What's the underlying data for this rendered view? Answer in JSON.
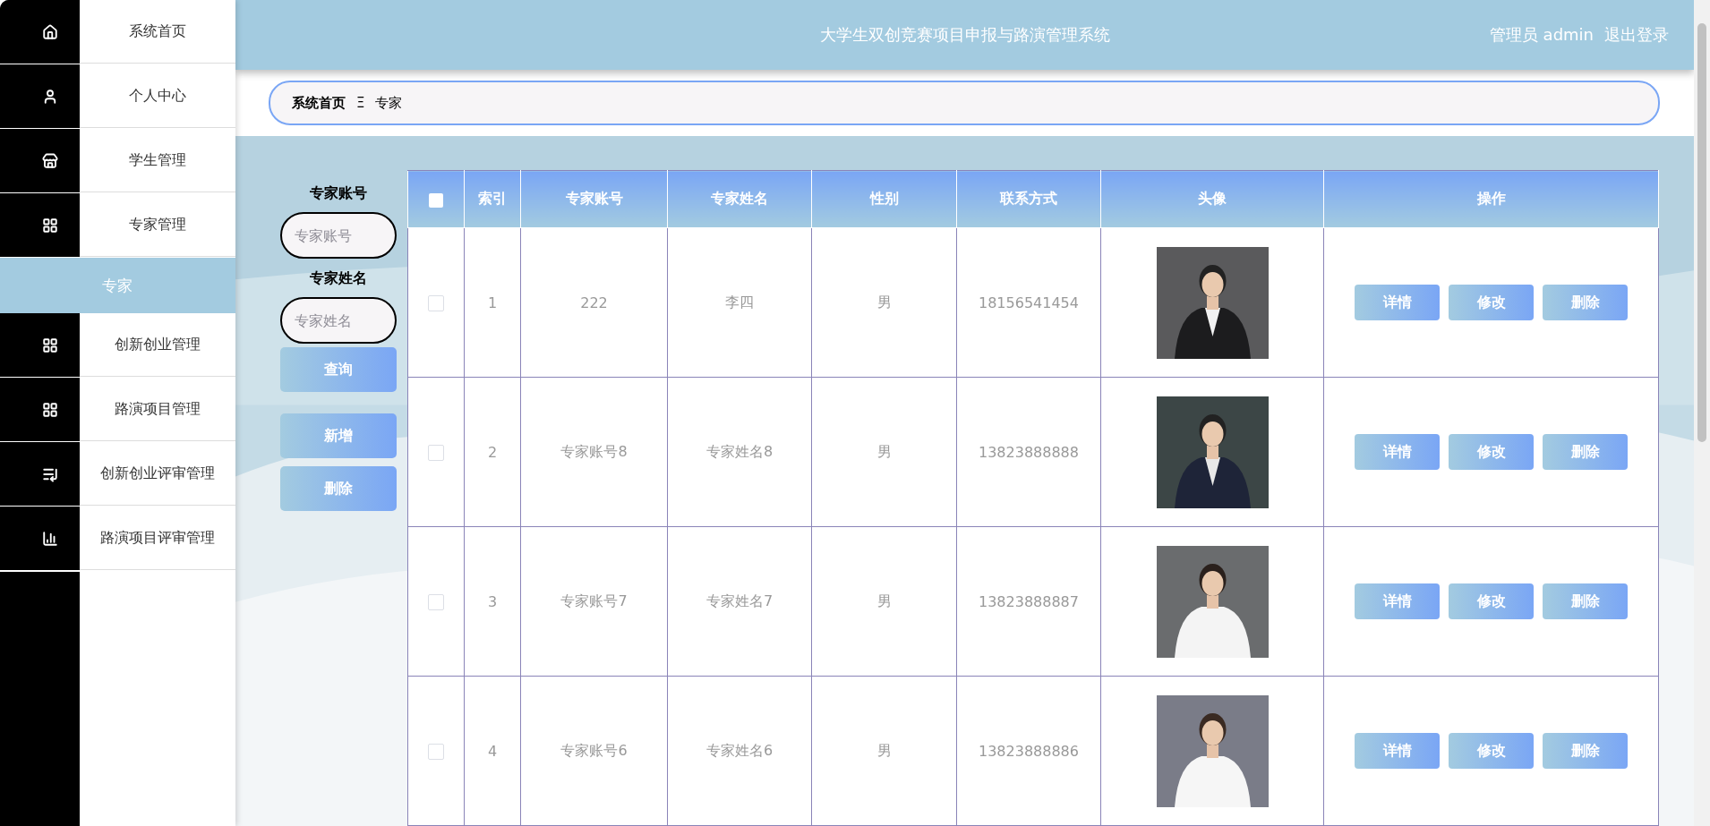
{
  "sidebar": {
    "items": [
      {
        "label": "系统首页",
        "selected": false
      },
      {
        "label": "个人中心",
        "selected": false
      },
      {
        "label": "学生管理",
        "selected": false
      },
      {
        "label": "专家管理",
        "selected": false,
        "expanded": true,
        "children": [
          {
            "label": "专家",
            "selected": true
          }
        ]
      },
      {
        "label": "创新创业管理",
        "selected": false
      },
      {
        "label": "路演项目管理",
        "selected": false
      },
      {
        "label": "创新创业评审管理",
        "selected": false
      },
      {
        "label": "路演项目评审管理",
        "selected": false
      }
    ]
  },
  "header": {
    "title": "大学生双创竞赛项目申报与路演管理系统",
    "user": "管理员 admin",
    "logout": "退出登录"
  },
  "breadcrumb": {
    "items": [
      "系统首页",
      "专家"
    ],
    "separator": "Ξ"
  },
  "search": {
    "fields": [
      {
        "label": "专家账号",
        "placeholder": "专家账号"
      },
      {
        "label": "专家姓名",
        "placeholder": "专家姓名"
      }
    ],
    "query_button": "查询",
    "add_button": "新增",
    "delete_button": "删除"
  },
  "table": {
    "select_all_checked": false,
    "columns": [
      "索引",
      "专家账号",
      "专家姓名",
      "性别",
      "联系方式",
      "头像",
      "操作"
    ],
    "rows": [
      {
        "checked": false,
        "index": "1",
        "account": "222",
        "name": "李四",
        "gender": "男",
        "phone": "18156541454",
        "photo": {
          "kind": "picture"
        },
        "actions": [
          "详情",
          "修改",
          "删除"
        ]
      },
      {
        "checked": false,
        "index": "2",
        "account": "专家账号8",
        "name": "专家姓名8",
        "gender": "男",
        "phone": "13823888888",
        "photo": {
          "kind": "picture"
        },
        "actions": [
          "详情",
          "修改",
          "删除"
        ]
      },
      {
        "checked": false,
        "index": "3",
        "account": "专家账号7",
        "name": "专家姓名7",
        "gender": "男",
        "phone": "13823888887",
        "photo": {
          "kind": "picture"
        },
        "actions": [
          "详情",
          "修改",
          "删除"
        ]
      },
      {
        "checked": false,
        "index": "4",
        "account": "专家账号6",
        "name": "专家姓名6",
        "gender": "男",
        "phone": "13823888886",
        "photo": {
          "kind": "picture"
        },
        "actions": [
          "详情",
          "修改",
          "删除"
        ]
      }
    ]
  }
}
